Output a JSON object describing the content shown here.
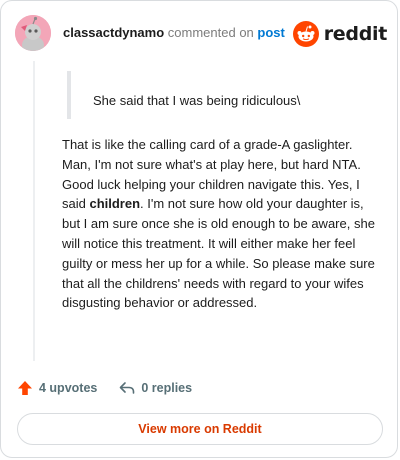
{
  "header": {
    "username": "classactdynamo",
    "commented_on": "commented on",
    "post_link": "post",
    "brand_word": "reddit"
  },
  "quote": {
    "text": "She said that I was being ridiculous\\"
  },
  "comment": {
    "before_bold": "That is like the calling card of a grade-A gaslighter. Man, I'm not sure what's at play here, but hard NTA. Good luck helping your children navigate this. Yes, I said ",
    "bold": "children",
    "after_bold": ". I'm not sure how old your daughter is, but I am sure once she is old enough to be aware, she will notice this treatment. It will either make her feel guilty or mess her up for a while. So please make sure that all the childrens' needs with regard to your wifes disgusting behavior or addressed."
  },
  "actions": {
    "upvotes": "4 upvotes",
    "replies": "0 replies"
  },
  "footer": {
    "view_more": "View more on Reddit"
  },
  "colors": {
    "accent": "#d93a00",
    "upvote": "#ff4500",
    "link": "#0079d3",
    "avatar": "#f3a6b8"
  }
}
